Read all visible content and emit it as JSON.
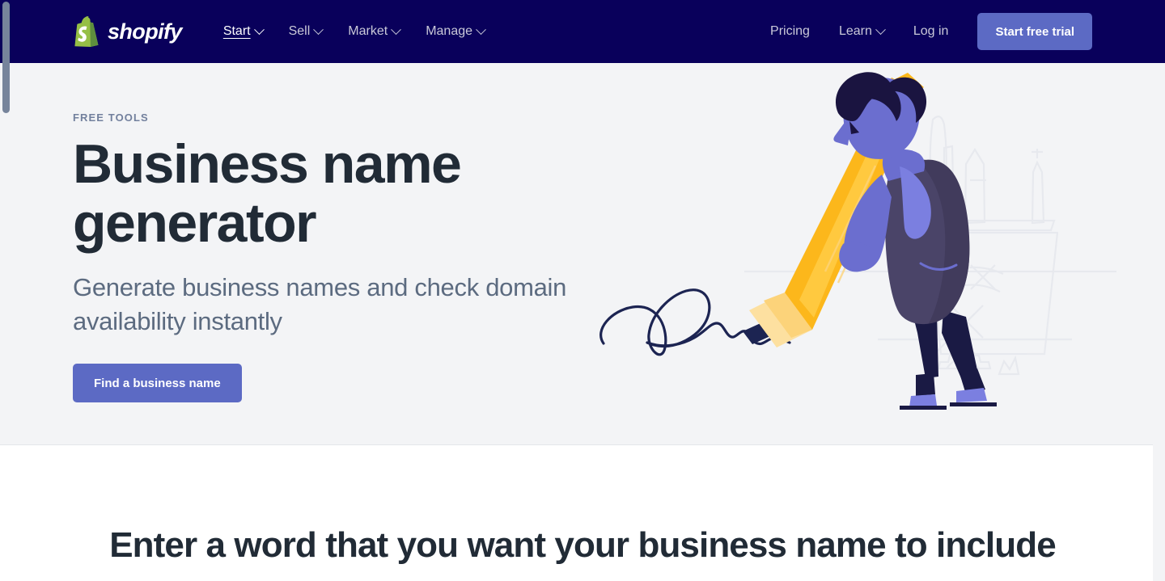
{
  "navbar": {
    "logo": {
      "name": "shopify",
      "wordmark": "shopify"
    },
    "primary_links": [
      {
        "label": "Start",
        "has_dropdown": true,
        "active": true
      },
      {
        "label": "Sell",
        "has_dropdown": true,
        "active": false
      },
      {
        "label": "Market",
        "has_dropdown": true,
        "active": false
      },
      {
        "label": "Manage",
        "has_dropdown": true,
        "active": false
      }
    ],
    "secondary_links": [
      {
        "label": "Pricing",
        "has_dropdown": false
      },
      {
        "label": "Learn",
        "has_dropdown": true
      },
      {
        "label": "Log in",
        "has_dropdown": false
      }
    ],
    "cta_label": "Start free trial",
    "background_color": "#09005b",
    "cta_color": "#5c6ac4"
  },
  "hero": {
    "eyebrow": "FREE TOOLS",
    "title_line1": "Business name",
    "title_line2": "generator",
    "subtitle": "Generate business names and check domain availability instantly",
    "cta_label": "Find a business name",
    "background_color": "#f3f4f6",
    "illustration": {
      "name": "person-pushing-giant-pencil",
      "pencil_color": "#fcb71b",
      "pencil_body_light": "#ffc93f",
      "pencil_tip_color": "#fde0a0",
      "skin_color": "#6b6ecf",
      "hair_color": "#1a1440",
      "dress_color": "#4a4468",
      "legs_color": "#1a1a44",
      "shoes_color": "#7b7fe0",
      "scribble_color": "#1c2452"
    }
  },
  "section2": {
    "heading": "Enter a word that you want your business name to include"
  },
  "scrollbar": {
    "name": "vertical-scrollbar",
    "thumb_color": "#76849b"
  }
}
